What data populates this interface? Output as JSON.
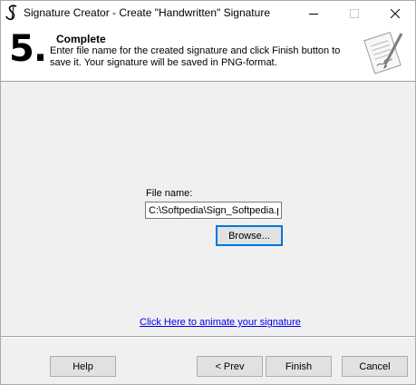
{
  "window": {
    "title": "Signature Creator - Create \"Handwritten\" Signature",
    "icon": "signature-s-icon",
    "controls": [
      "minimize-icon",
      "maximize-icon",
      "close-icon"
    ]
  },
  "header": {
    "step_number": "5.",
    "step_title": "Complete",
    "description": "Enter file name for the created signature and click Finish button to save it. Your signature will be saved in PNG-format.",
    "art_icon": "signature-document-icon"
  },
  "content": {
    "file_name_label": "File name:",
    "file_name_value": "C:\\Softpedia\\Sign_Softpedia.png",
    "browse_label": "Browse...",
    "animate_link": "Click Here to animate your signature"
  },
  "footer": {
    "help_label": "Help",
    "prev_label": "< Prev",
    "finish_label": "Finish",
    "cancel_label": "Cancel"
  }
}
